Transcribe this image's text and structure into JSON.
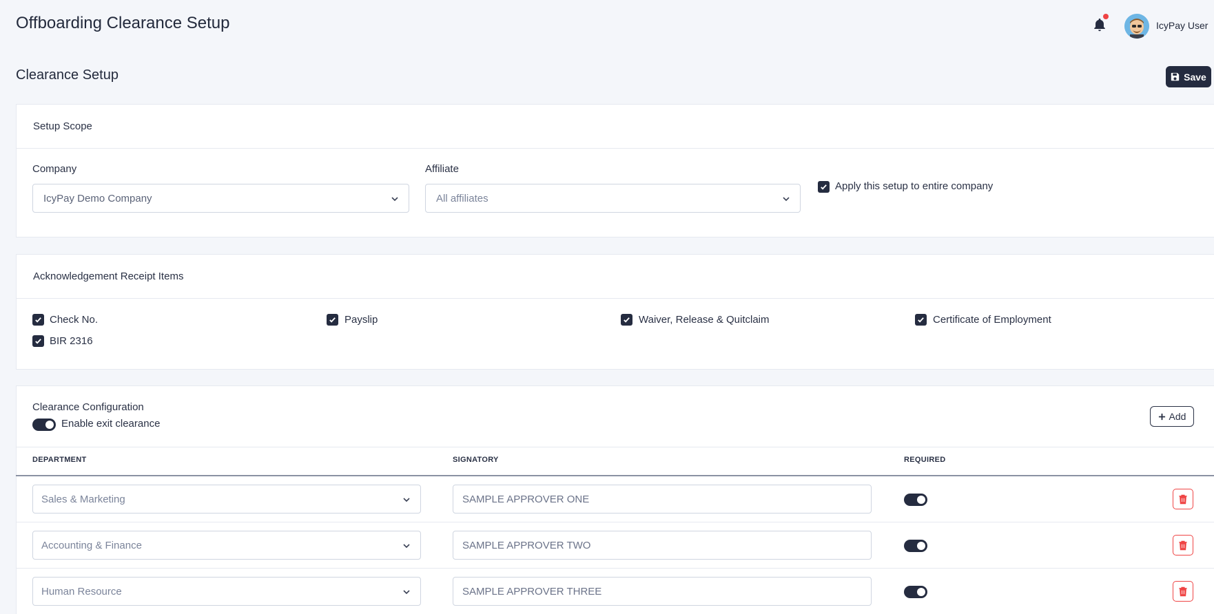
{
  "app": {
    "title": "Offboarding Clearance Setup",
    "user_name": "IcyPay User",
    "notification_indicator": true
  },
  "page": {
    "title": "Clearance Setup",
    "save_label": "Save"
  },
  "setup_scope": {
    "title": "Setup Scope",
    "company_label": "Company",
    "company_value": "IcyPay Demo Company",
    "affiliate_label": "Affiliate",
    "affiliate_value": "All affiliates",
    "apply_label": "Apply this setup to entire company",
    "apply_checked": true
  },
  "acknowledgement": {
    "title": "Acknowledgement Receipt Items",
    "items": [
      {
        "label": "Check No.",
        "checked": true
      },
      {
        "label": "Payslip",
        "checked": true
      },
      {
        "label": "Waiver, Release & Quitclaim",
        "checked": true
      },
      {
        "label": "Certificate of Employment",
        "checked": true
      },
      {
        "label": "BIR 2316",
        "checked": true
      }
    ]
  },
  "clearance": {
    "title": "Clearance Configuration",
    "enable_label": "Enable exit clearance",
    "enabled": true,
    "add_label": "Add",
    "columns": {
      "department": "DEPARTMENT",
      "signatory": "SIGNATORY",
      "required": "REQUIRED"
    },
    "rows": [
      {
        "department": "Sales & Marketing",
        "signatory": "SAMPLE APPROVER ONE",
        "required": true
      },
      {
        "department": "Accounting & Finance",
        "signatory": "SAMPLE APPROVER TWO",
        "required": true
      },
      {
        "department": "Human Resource",
        "signatory": "SAMPLE APPROVER THREE",
        "required": true
      }
    ]
  },
  "colors": {
    "primary_dark": "#242b3f",
    "danger": "#ef4444",
    "background": "#f4f6fa"
  },
  "icons": {
    "notification": "bell-icon",
    "save": "floppy-disk-icon",
    "add": "plus-icon",
    "delete": "trash-icon",
    "dropdown": "chevron-down-icon"
  }
}
